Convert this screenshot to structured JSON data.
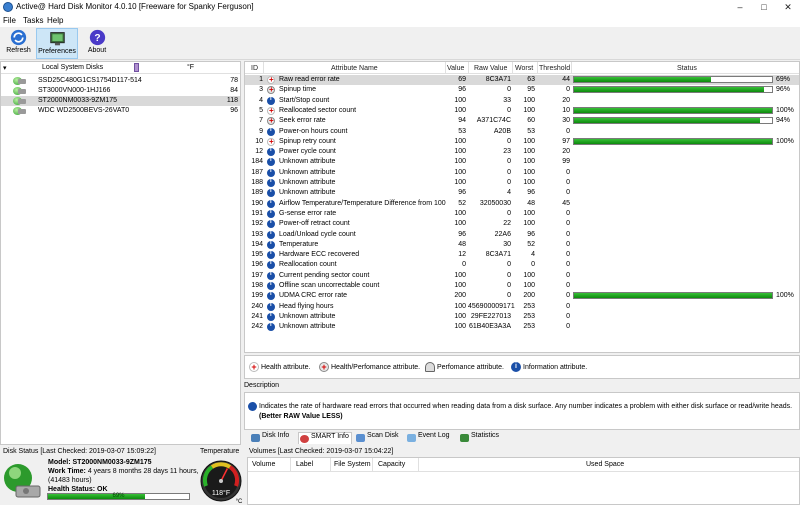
{
  "window": {
    "title": "Active@ Hard Disk Monitor 4.0.10 [Freeware for Spanky Ferguson]"
  },
  "menu": [
    "File",
    "Tasks",
    "Help"
  ],
  "toolbar": {
    "refresh": "Refresh",
    "preferences": "Preferences",
    "about": "About"
  },
  "disks_panel": {
    "header_name": "Local System Disks",
    "header_temp": "°F",
    "disks": [
      {
        "name": "SSD25C480G1CS1754D117-514",
        "temp": "78"
      },
      {
        "name": "ST3000VN000-1HJ166",
        "temp": "84"
      },
      {
        "name": "ST2000NM0033-9ZM175",
        "temp": "118"
      },
      {
        "name": "WDC WD2500BEVS-26VAT0",
        "temp": "96"
      }
    ]
  },
  "attributes": {
    "headers": {
      "id": "ID",
      "name": "Attribute Name",
      "value": "Value",
      "raw": "Raw Value",
      "worst": "Worst",
      "threshold": "Threshold",
      "status": "Status"
    },
    "rows": [
      {
        "id": "1",
        "icon": "health",
        "name": "Raw read error rate",
        "value": "69",
        "raw": "8C3A71",
        "worst": "63",
        "threshold": "44",
        "status": 0.69,
        "pct": "69%"
      },
      {
        "id": "3",
        "icon": "hp",
        "name": "Spinup time",
        "value": "96",
        "raw": "0",
        "worst": "95",
        "threshold": "0",
        "status": 0.96,
        "pct": "96%"
      },
      {
        "id": "4",
        "icon": "info",
        "name": "Start/Stop count",
        "value": "100",
        "raw": "33",
        "worst": "100",
        "threshold": "20"
      },
      {
        "id": "5",
        "icon": "health",
        "name": "Reallocated sector count",
        "value": "100",
        "raw": "0",
        "worst": "100",
        "threshold": "10",
        "status": 1.0,
        "pct": "100%"
      },
      {
        "id": "7",
        "icon": "hp",
        "name": "Seek error rate",
        "value": "94",
        "raw": "A371C74C",
        "worst": "60",
        "threshold": "30",
        "status": 0.94,
        "pct": "94%"
      },
      {
        "id": "9",
        "icon": "info",
        "name": "Power-on hours count",
        "value": "53",
        "raw": "A20B",
        "worst": "53",
        "threshold": "0"
      },
      {
        "id": "10",
        "icon": "health",
        "name": "Spinup retry count",
        "value": "100",
        "raw": "0",
        "worst": "100",
        "threshold": "97",
        "status": 1.0,
        "pct": "100%"
      },
      {
        "id": "12",
        "icon": "info",
        "name": "Power cycle count",
        "value": "100",
        "raw": "23",
        "worst": "100",
        "threshold": "20"
      },
      {
        "id": "184",
        "icon": "info",
        "name": "Unknown attribute",
        "value": "100",
        "raw": "0",
        "worst": "100",
        "threshold": "99"
      },
      {
        "id": "187",
        "icon": "info",
        "name": "Unknown attribute",
        "value": "100",
        "raw": "0",
        "worst": "100",
        "threshold": "0"
      },
      {
        "id": "188",
        "icon": "info",
        "name": "Unknown attribute",
        "value": "100",
        "raw": "0",
        "worst": "100",
        "threshold": "0"
      },
      {
        "id": "189",
        "icon": "info",
        "name": "Unknown attribute",
        "value": "96",
        "raw": "4",
        "worst": "96",
        "threshold": "0"
      },
      {
        "id": "190",
        "icon": "info",
        "name": "Airflow Temperature/Temperature Difference from 100",
        "value": "52",
        "raw": "32050030",
        "worst": "48",
        "threshold": "45"
      },
      {
        "id": "191",
        "icon": "info",
        "name": "G-sense error rate",
        "value": "100",
        "raw": "0",
        "worst": "100",
        "threshold": "0"
      },
      {
        "id": "192",
        "icon": "info",
        "name": "Power-off retract count",
        "value": "100",
        "raw": "22",
        "worst": "100",
        "threshold": "0"
      },
      {
        "id": "193",
        "icon": "info",
        "name": "Load/Unload cycle count",
        "value": "96",
        "raw": "22A6",
        "worst": "96",
        "threshold": "0"
      },
      {
        "id": "194",
        "icon": "info",
        "name": "Temperature",
        "value": "48",
        "raw": "30",
        "worst": "52",
        "threshold": "0"
      },
      {
        "id": "195",
        "icon": "info",
        "name": "Hardware ECC recovered",
        "value": "12",
        "raw": "8C3A71",
        "worst": "4",
        "threshold": "0"
      },
      {
        "id": "196",
        "icon": "info",
        "name": "Reallocation count",
        "value": "0",
        "raw": "0",
        "worst": "0",
        "threshold": "0"
      },
      {
        "id": "197",
        "icon": "info",
        "name": "Current pending sector count",
        "value": "100",
        "raw": "0",
        "worst": "100",
        "threshold": "0"
      },
      {
        "id": "198",
        "icon": "info",
        "name": "Offline scan uncorrectable count",
        "value": "100",
        "raw": "0",
        "worst": "100",
        "threshold": "0"
      },
      {
        "id": "199",
        "icon": "info",
        "name": "UDMA CRC error rate",
        "value": "200",
        "raw": "0",
        "worst": "200",
        "threshold": "0",
        "status": 1.0,
        "pct": "100%"
      },
      {
        "id": "240",
        "icon": "info",
        "name": "Head flying hours",
        "value": "100",
        "raw": "456900009171",
        "worst": "253",
        "threshold": "0"
      },
      {
        "id": "241",
        "icon": "info",
        "name": "Unknown attribute",
        "value": "100",
        "raw": "29FE227013",
        "worst": "253",
        "threshold": "0"
      },
      {
        "id": "242",
        "icon": "info",
        "name": "Unknown attribute",
        "value": "100",
        "raw": "61B40E3A3A",
        "worst": "253",
        "threshold": "0"
      }
    ]
  },
  "legend": {
    "health": "Health attribute.",
    "health_perf": "Health/Perfomance attribute.",
    "perf": "Perfomance attribute.",
    "info": "Information attribute."
  },
  "description": {
    "label": "Description",
    "text": "Indicates the rate of hardware read errors that occurred when reading data from a disk surface. Any number indicates a problem with either disk surface or read/write heads.",
    "bold": "(Better RAW Value LESS)"
  },
  "tabs": [
    "Disk Info",
    "SMART Info",
    "Scan Disk",
    "Event Log",
    "Statistics"
  ],
  "disk_status": {
    "label": "Disk Status [Last Checked: 2019-03-07 15:09:22]",
    "model_label": "Model:",
    "model": "ST2000NM0033-9ZM175",
    "work_label": "Work Time:",
    "work": "4 years 8 months 28 days 11 hours,",
    "work2": "(41483 hours)",
    "health_label": "Health Status:",
    "health": "OK",
    "health_pct": 0.69,
    "health_pct_label": "69%"
  },
  "temperature": {
    "label": "Temperature",
    "value": "118°F",
    "unit": "°C",
    "level": 0.6
  },
  "volumes": {
    "label": "Volumes [Last Checked: 2019-03-07 15:04:22]",
    "headers": [
      "Volume",
      "Label",
      "File System",
      "Capacity",
      "Used Space"
    ]
  },
  "colors": {
    "status_fill": "#1a9a1a",
    "selected_row": "#d9d9d9",
    "toolbar_active": "#cde6f7"
  }
}
